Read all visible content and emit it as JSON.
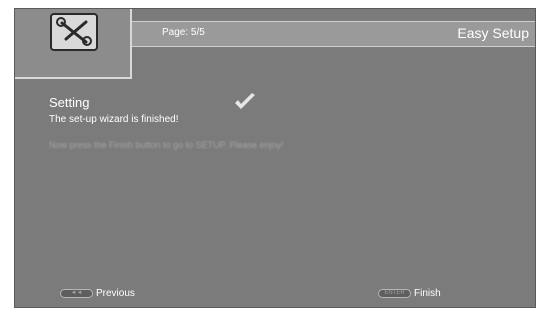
{
  "logo": {
    "icon": "wrench-screwdriver-icon"
  },
  "header": {
    "page_indicator": "Page: 5/5",
    "title": "Easy Setup"
  },
  "content": {
    "heading": "Setting",
    "message": "The set-up wizard is finished!",
    "instructions": "Now press the Finish button to go to SETUP. Please enjoy!",
    "status_icon": "check-icon"
  },
  "footer": {
    "previous": {
      "key_label": "◄◄",
      "label": "Previous"
    },
    "finish": {
      "key_label": "ENTER",
      "label": "Finish"
    }
  },
  "colors": {
    "screen_background": "#7b7b7b",
    "header_bar": "#9a9a9a",
    "text": "#ffffff"
  }
}
